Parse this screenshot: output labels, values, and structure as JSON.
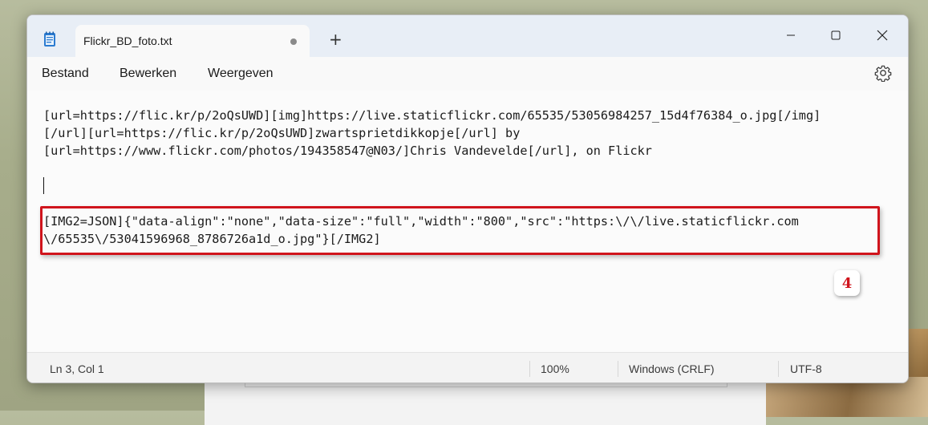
{
  "tab": {
    "title": "Flickr_BD_foto.txt"
  },
  "new_tab_label": "+",
  "menu": {
    "file": "Bestand",
    "edit": "Bewerken",
    "view": "Weergeven"
  },
  "editor": {
    "lines": [
      "[url=https://flic.kr/p/2oQsUWD][img]https://live.staticflickr.com/65535/53056984257_15d4f76384_o.jpg[/img]",
      "[/url][url=https://flic.kr/p/2oQsUWD]zwartsprietdikkopje[/url] by",
      "[url=https://www.flickr.com/photos/194358547@N03/]Chris Vandevelde[/url], on Flickr"
    ],
    "highlighted_lines": [
      "[IMG2=JSON]{\"data-align\":\"none\",\"data-size\":\"full\",\"width\":\"800\",\"src\":\"https:\\/\\/live.staticflickr.com",
      "\\/65535\\/53041596968_8786726a1d_o.jpg\"}[/IMG2]"
    ]
  },
  "annotation": {
    "badge": "4",
    "color": "#d0141c"
  },
  "status": {
    "position": "Ln 3, Col 1",
    "zoom": "100%",
    "line_ending": "Windows (CRLF)",
    "encoding": "UTF-8"
  }
}
